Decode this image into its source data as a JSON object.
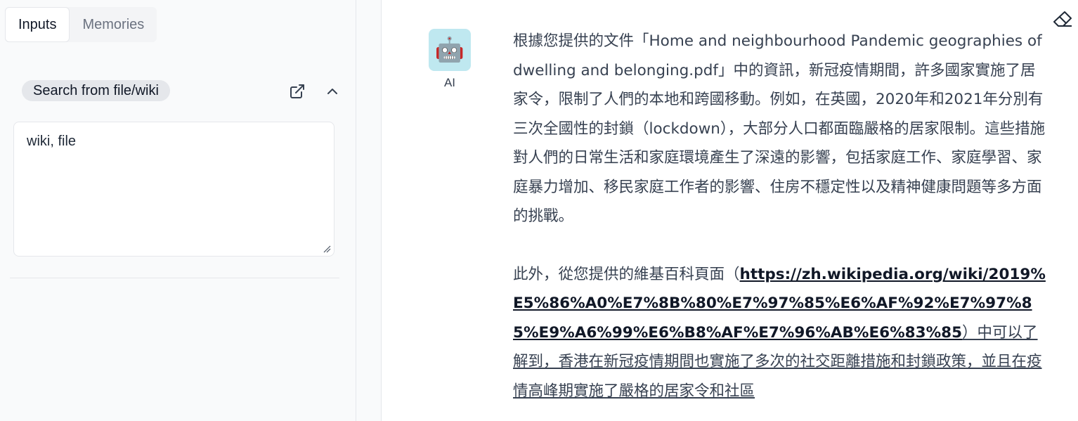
{
  "tabs": [
    {
      "label": "Inputs",
      "active": true
    },
    {
      "label": "Memories",
      "active": false
    }
  ],
  "search": {
    "pill_label": "Search from file/wiki",
    "textarea_value": "wiki, file",
    "icons": [
      "external-link-icon",
      "chevron-up-icon"
    ]
  },
  "chat": {
    "avatar_emoji": "🤖",
    "avatar_label": "AI",
    "para1": "根據您提供的文件「Home and neighbourhood Pandemic geographies of dwelling and belonging.pdf」中的資訊，新冠疫情期間，許多國家實施了居家令，限制了人們的本地和跨國移動。例如，在英國，2020年和2021年分別有三次全國性的封鎖（lockdown），大部分人口都面臨嚴格的居家限制。這些措施對人們的日常生活和家庭環境產生了深遠的影響，包括家庭工作、家庭學習、家庭暴力增加、移民家庭工作者的影響、住房不穩定性以及精神健康問題等多方面的挑戰。",
    "para2_prefix": "此外，從您提供的維基百科頁面（",
    "para2_link": "https://zh.wikipedia.org/wiki/2019%E5%86%A0%E7%8B%80%E7%97%85%E6%AF%92%E7%97%85%E9%A6%99%E6%B8%AF%E7%96%AB%E6%83%85",
    "para2_suffix": "）中可以了解到，香港在新冠疫情期間也實施了多次的社交距離措施和封鎖政策，並且在疫情高峰期實施了嚴格的居家令和社區"
  },
  "colors": {
    "accent_avatar": "#bfe8f0",
    "panel_bg": "#f9fafb"
  }
}
